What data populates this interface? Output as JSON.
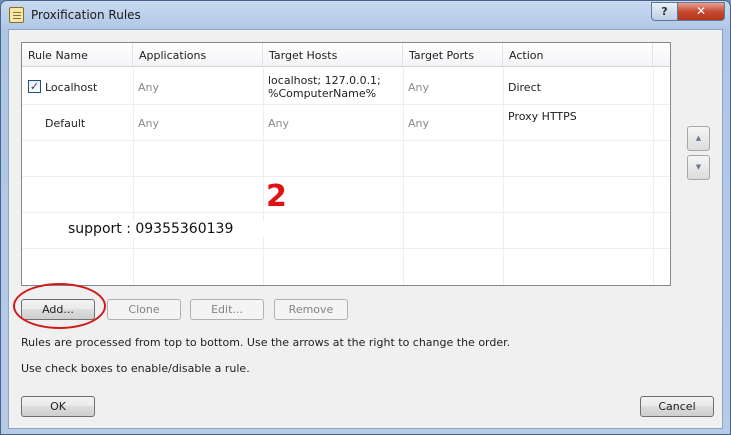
{
  "window": {
    "title": "Proxification Rules",
    "help_label": "?",
    "close_label": "✕"
  },
  "table": {
    "columns": [
      "Rule Name",
      "Applications",
      "Target Hosts",
      "Target Ports",
      "Action"
    ],
    "rows": [
      {
        "checked": true,
        "name": "Localhost",
        "applications": "Any",
        "target_hosts_line1": "localhost; 127.0.0.1;",
        "target_hosts_line2": "%ComputerName%",
        "target_ports": "Any",
        "action": "Direct"
      },
      {
        "checked": null,
        "name": "Default",
        "applications": "Any",
        "target_hosts_line1": "Any",
        "target_hosts_line2": "",
        "target_ports": "Any",
        "action": "Proxy HTTPS"
      }
    ]
  },
  "overlay": {
    "number": "2",
    "support_text": "support : 09355360139"
  },
  "buttons": {
    "add": "Add...",
    "clone": "Clone",
    "edit": "Edit...",
    "remove": "Remove",
    "ok": "OK",
    "cancel": "Cancel"
  },
  "order_controls": {
    "up_icon": "▲",
    "down_icon": "▼"
  },
  "info": {
    "line1": "Rules are processed from top to bottom. Use the arrows at the right to change the order.",
    "line2": "Use check boxes to enable/disable a rule."
  },
  "colors": {
    "highlight_annotation": "#d01a1a",
    "overlay_number": "#e01313"
  }
}
